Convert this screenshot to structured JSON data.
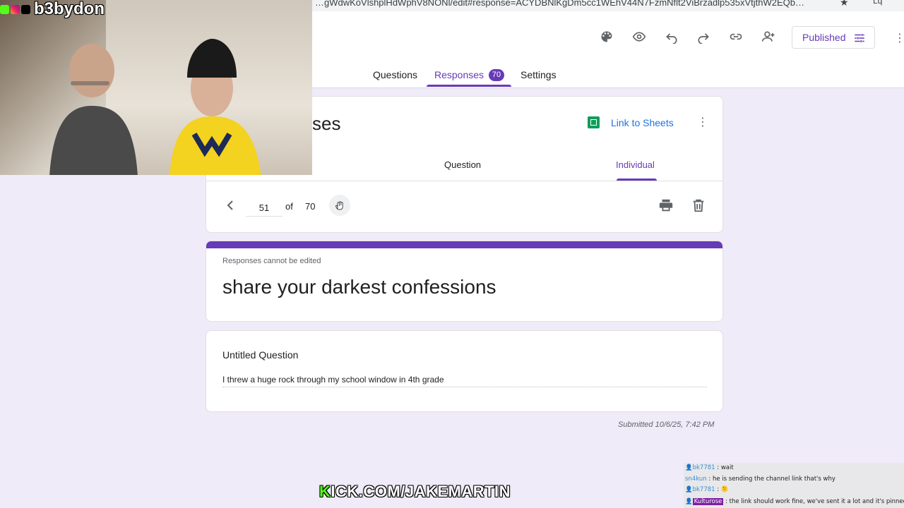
{
  "browser": {
    "url": "…gWdwKoVlshplHdWphV8NONl/edit#response=ACYDBNlKgDm5cc1WEhV44N7FzmNflt2ViBrzadlp535xVtjthW2EQb…"
  },
  "header": {
    "tabs": [
      {
        "label": "Questions"
      },
      {
        "label": "Responses",
        "badge": "70"
      },
      {
        "label": "Settings"
      }
    ],
    "publish_label": "Published",
    "icons": [
      "palette-icon",
      "preview-eye-icon",
      "undo-icon",
      "redo-icon",
      "link-icon",
      "add-collaborator-icon",
      "tune-icon",
      "more-vert-icon"
    ]
  },
  "summary": {
    "title_fragment": "ses",
    "link_to_sheets": "Link to Sheets",
    "subtabs": [
      "Question",
      "Individual"
    ],
    "active_subtab": "Individual"
  },
  "navigator": {
    "current": "51",
    "of_label": "of",
    "total": "70"
  },
  "form": {
    "note": "Responses cannot be edited",
    "title": "share your darkest confessions",
    "accent": "#673ab7"
  },
  "question": {
    "title": "Untitled Question",
    "answer": "I threw a huge rock through my school window in 4th grade"
  },
  "submitted": "Submitted 10/6/25, 7:42 PM",
  "stream": {
    "handle": "b3bydon",
    "kick_k": "K",
    "kick_rest": "ICK.COM/JAKEMARTIN",
    "chat": [
      {
        "user": "bk7781",
        "sep": " : ",
        "text": "wait"
      },
      {
        "user": "sn4kun",
        "sep": " : ",
        "text": "he is sending the channel link that's why"
      },
      {
        "user": "bk7781",
        "sep": " : ",
        "text": "🫠"
      },
      {
        "user": "Kulturose",
        "sep": " : ",
        "text": "the link should work fine, we've sent it a lot and it's pinned"
      }
    ]
  }
}
